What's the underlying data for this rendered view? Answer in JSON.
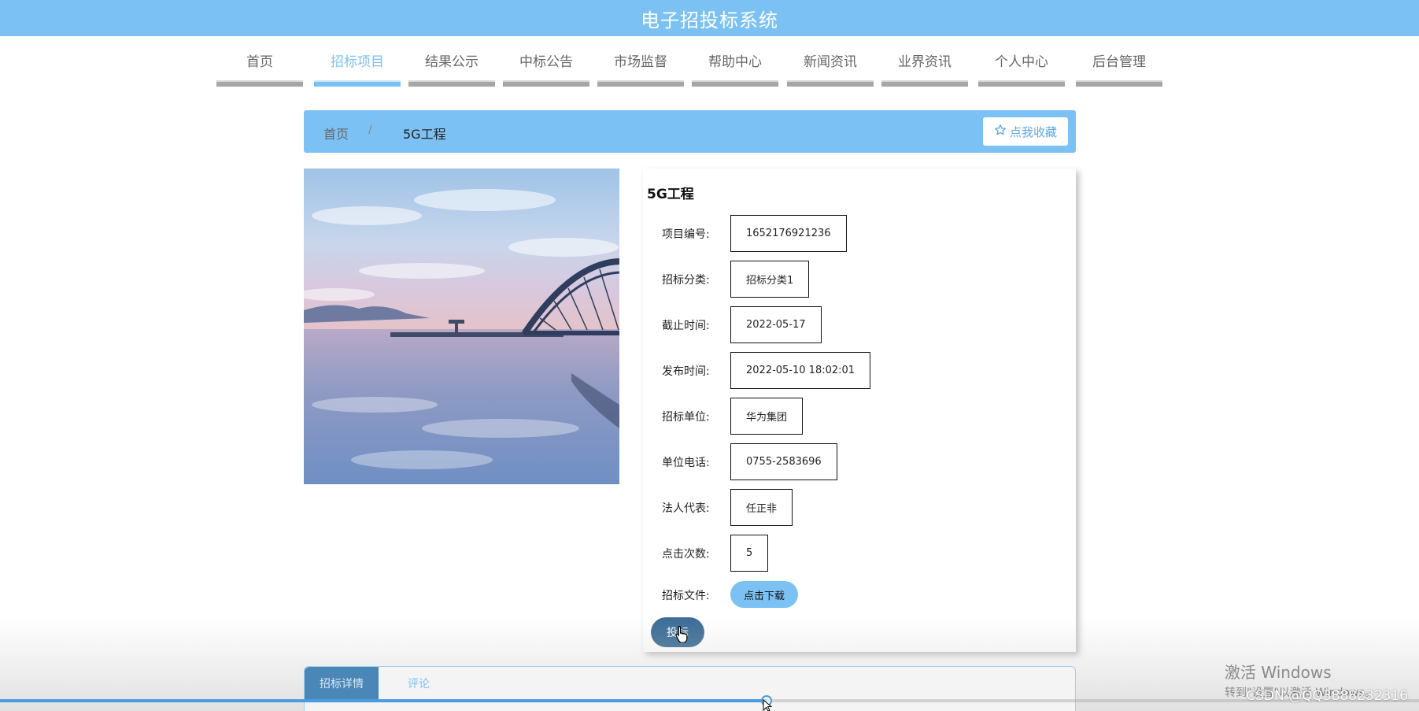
{
  "header": {
    "title": "电子招投标系统"
  },
  "nav": {
    "items": [
      {
        "label": "首页",
        "active": false
      },
      {
        "label": "招标项目",
        "active": true
      },
      {
        "label": "结果公示",
        "active": false
      },
      {
        "label": "中标公告",
        "active": false
      },
      {
        "label": "市场监督",
        "active": false
      },
      {
        "label": "帮助中心",
        "active": false
      },
      {
        "label": "新闻资讯",
        "active": false
      },
      {
        "label": "业界资讯",
        "active": false
      },
      {
        "label": "个人中心",
        "active": false
      },
      {
        "label": "后台管理",
        "active": false
      }
    ]
  },
  "breadcrumb": {
    "home": "首页",
    "separator": "/",
    "current": "5G工程",
    "favorite_label": "点我收藏",
    "favorite_icon": "star-outline-icon"
  },
  "detail": {
    "title": "5G工程",
    "fields": [
      {
        "label": "项目编号:",
        "value": "1652176921236"
      },
      {
        "label": "招标分类:",
        "value": "招标分类1"
      },
      {
        "label": "截止时间:",
        "value": "2022-05-17"
      },
      {
        "label": "发布时间:",
        "value": "2022-05-10 18:02:01"
      },
      {
        "label": "招标单位:",
        "value": "华为集团"
      },
      {
        "label": "单位电话:",
        "value": "0755-2583696"
      },
      {
        "label": "法人代表:",
        "value": "任正非"
      },
      {
        "label": "点击次数:",
        "value": "5"
      }
    ],
    "file_label": "招标文件:",
    "download_label": "点击下载",
    "bid_label": "投标"
  },
  "tabs": [
    {
      "label": "招标详情",
      "active": true
    },
    {
      "label": "评论",
      "active": false
    }
  ],
  "video": {
    "progress": 0.54
  },
  "overlay": {
    "windows_line1": "激活 Windows",
    "windows_line2": "转到\"设置\"以激活 Windows。",
    "watermark": "CSDN @QQ3888232316"
  },
  "colors": {
    "accent": "#7cc1f4",
    "button_dark": "#3d6e96",
    "nav_bar": "#a6a6a6"
  }
}
